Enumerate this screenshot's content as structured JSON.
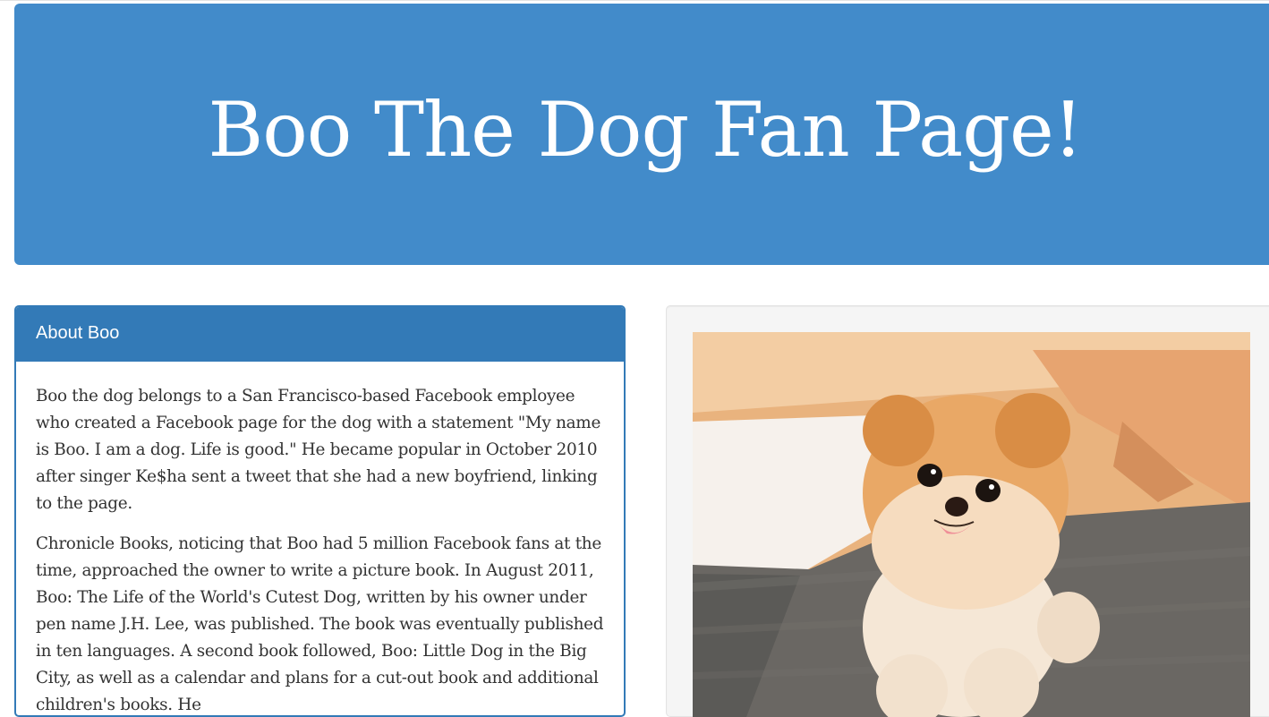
{
  "header": {
    "title": "Boo The Dog Fan Page!"
  },
  "about": {
    "heading": "About Boo",
    "paragraphs": [
      "Boo the dog belongs to a San Francisco-based Facebook employee who created a Facebook page for the dog with a statement \"My name is Boo. I am a dog. Life is good.\" He became popular in October 2010 after singer Ke$ha sent a tweet that she had a new boyfriend, linking to the page.",
      "Chronicle Books, noticing that Boo had 5 million Facebook fans at the time, approached the owner to write a picture book. In August 2011, Boo: The Life of the World's Cutest Dog, written by his owner under pen name J.H. Lee, was published. The book was eventually published in ten languages. A second book followed, Boo: Little Dog in the Big City, as well as a calendar and plans for a cut-out book and additional children's books. He"
    ]
  },
  "photo": {
    "icon": "pomeranian-dog-photo"
  },
  "colors": {
    "header_bg": "#428bca",
    "panel_primary": "#337ab7",
    "well_bg": "#f5f5f5"
  }
}
